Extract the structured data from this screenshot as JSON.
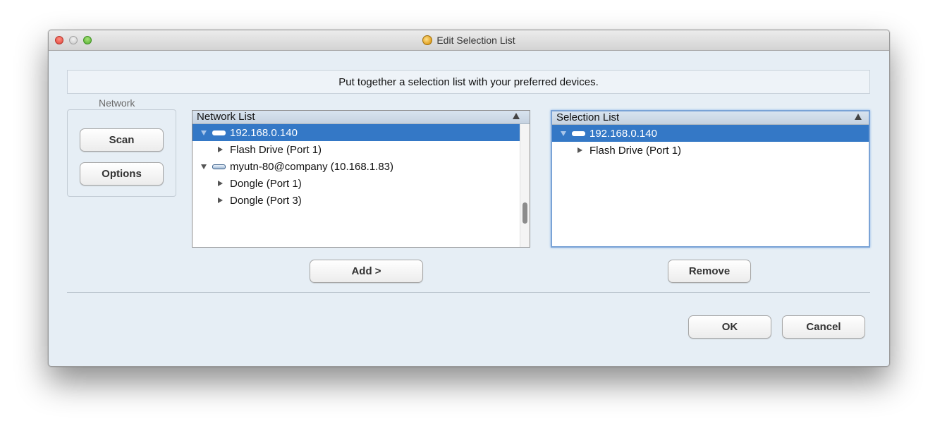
{
  "window": {
    "title": "Edit Selection List",
    "app_icon": "app-icon"
  },
  "banner": {
    "text": "Put together a selection list with your preferred devices."
  },
  "network_group": {
    "label": "Network",
    "scan_label": "Scan",
    "options_label": "Options"
  },
  "network_list": {
    "header": "Network List",
    "rows": [
      {
        "text": "192.168.0.140",
        "level": 0,
        "expanded": true,
        "selected": true
      },
      {
        "text": "Flash Drive (Port 1)",
        "level": 1,
        "expanded": false,
        "selected": false
      },
      {
        "text": "myutn-80@company (10.168.1.83)",
        "level": 0,
        "expanded": true,
        "selected": false
      },
      {
        "text": "Dongle (Port 1)",
        "level": 1,
        "expanded": false,
        "selected": false
      },
      {
        "text": "Dongle (Port 3)",
        "level": 1,
        "expanded": false,
        "selected": false
      }
    ]
  },
  "selection_list": {
    "header": "Selection List",
    "rows": [
      {
        "text": "192.168.0.140",
        "level": 0,
        "expanded": true,
        "selected": true
      },
      {
        "text": "Flash Drive (Port 1)",
        "level": 1,
        "expanded": false,
        "selected": false
      }
    ]
  },
  "actions": {
    "add_label": "Add >",
    "remove_label": "Remove",
    "ok_label": "OK",
    "cancel_label": "Cancel"
  },
  "colors": {
    "selection": "#3478c6",
    "window_bg": "#e6eef5",
    "focus_ring": "#7aa3d6"
  }
}
